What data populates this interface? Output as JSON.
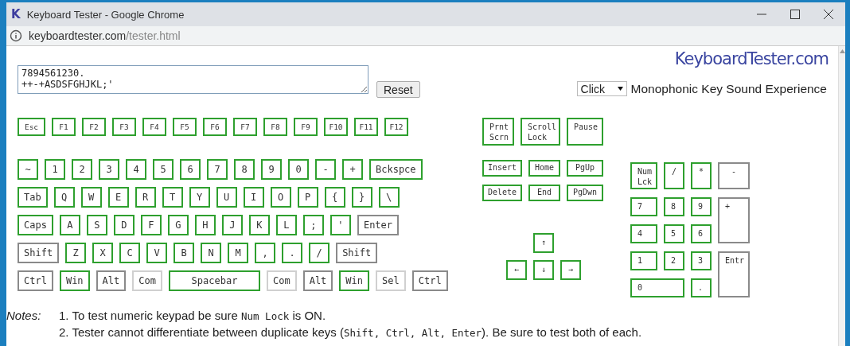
{
  "window": {
    "icon_letter": "K",
    "title": "Keyboard Tester - Google Chrome",
    "url_domain": "keyboardtester.com",
    "url_path": "/tester.html"
  },
  "input": {
    "value": "7894561230.\n++-+ASDSFGHJKL;'"
  },
  "reset_button": "Reset",
  "logo": "KeyboardTester.com",
  "sound": {
    "value": "Click",
    "label": "Monophonic Key Sound Experience"
  },
  "function_row": [
    {
      "label": "Esc",
      "tested": true,
      "disabled": false
    },
    {
      "label": "F1",
      "tested": true,
      "disabled": false
    },
    {
      "label": "F2",
      "tested": true,
      "disabled": false
    },
    {
      "label": "F3",
      "tested": true,
      "disabled": false
    },
    {
      "label": "F4",
      "tested": true,
      "disabled": false
    },
    {
      "label": "F5",
      "tested": true,
      "disabled": false
    },
    {
      "label": "F6",
      "tested": true,
      "disabled": false
    },
    {
      "label": "F7",
      "tested": true,
      "disabled": false
    },
    {
      "label": "F8",
      "tested": true,
      "disabled": false
    },
    {
      "label": "F9",
      "tested": true,
      "disabled": false
    },
    {
      "label": "F10",
      "tested": true,
      "disabled": false
    },
    {
      "label": "F11",
      "tested": true,
      "disabled": false
    },
    {
      "label": "F12",
      "tested": true,
      "disabled": false
    }
  ],
  "main_rows": [
    [
      {
        "label": "~",
        "tested": true,
        "disabled": false
      },
      {
        "label": "1",
        "tested": true,
        "disabled": false
      },
      {
        "label": "2",
        "tested": true,
        "disabled": false
      },
      {
        "label": "3",
        "tested": true,
        "disabled": false
      },
      {
        "label": "4",
        "tested": true,
        "disabled": false
      },
      {
        "label": "5",
        "tested": true,
        "disabled": false
      },
      {
        "label": "6",
        "tested": true,
        "disabled": false
      },
      {
        "label": "7",
        "tested": true,
        "disabled": false
      },
      {
        "label": "8",
        "tested": true,
        "disabled": false
      },
      {
        "label": "9",
        "tested": true,
        "disabled": false
      },
      {
        "label": "0",
        "tested": true,
        "disabled": false
      },
      {
        "label": "-",
        "tested": true,
        "disabled": false
      },
      {
        "label": "+",
        "tested": true,
        "disabled": false
      },
      {
        "label": "Bckspce",
        "tested": true,
        "disabled": false
      }
    ],
    [
      {
        "label": "Tab",
        "tested": true,
        "disabled": false
      },
      {
        "label": "Q",
        "tested": true,
        "disabled": false
      },
      {
        "label": "W",
        "tested": true,
        "disabled": false
      },
      {
        "label": "E",
        "tested": true,
        "disabled": false
      },
      {
        "label": "R",
        "tested": true,
        "disabled": false
      },
      {
        "label": "T",
        "tested": true,
        "disabled": false
      },
      {
        "label": "Y",
        "tested": true,
        "disabled": false
      },
      {
        "label": "U",
        "tested": true,
        "disabled": false
      },
      {
        "label": "I",
        "tested": true,
        "disabled": false
      },
      {
        "label": "O",
        "tested": true,
        "disabled": false
      },
      {
        "label": "P",
        "tested": true,
        "disabled": false
      },
      {
        "label": "{",
        "tested": true,
        "disabled": false
      },
      {
        "label": "}",
        "tested": true,
        "disabled": false
      },
      {
        "label": "\\",
        "tested": true,
        "disabled": false
      }
    ],
    [
      {
        "label": "Caps",
        "tested": true,
        "disabled": false
      },
      {
        "label": "A",
        "tested": true,
        "disabled": false
      },
      {
        "label": "S",
        "tested": true,
        "disabled": false
      },
      {
        "label": "D",
        "tested": true,
        "disabled": false
      },
      {
        "label": "F",
        "tested": true,
        "disabled": false
      },
      {
        "label": "G",
        "tested": true,
        "disabled": false
      },
      {
        "label": "H",
        "tested": true,
        "disabled": false
      },
      {
        "label": "J",
        "tested": true,
        "disabled": false
      },
      {
        "label": "K",
        "tested": true,
        "disabled": false
      },
      {
        "label": "L",
        "tested": true,
        "disabled": false
      },
      {
        "label": ";",
        "tested": true,
        "disabled": false
      },
      {
        "label": "'",
        "tested": true,
        "disabled": false
      },
      {
        "label": "Enter",
        "tested": false,
        "disabled": false
      }
    ],
    [
      {
        "label": "Shift",
        "tested": false,
        "disabled": false
      },
      {
        "label": "Z",
        "tested": true,
        "disabled": false
      },
      {
        "label": "X",
        "tested": true,
        "disabled": false
      },
      {
        "label": "C",
        "tested": true,
        "disabled": false
      },
      {
        "label": "V",
        "tested": true,
        "disabled": false
      },
      {
        "label": "B",
        "tested": true,
        "disabled": false
      },
      {
        "label": "N",
        "tested": true,
        "disabled": false
      },
      {
        "label": "M",
        "tested": true,
        "disabled": false
      },
      {
        "label": ",",
        "tested": true,
        "disabled": false
      },
      {
        "label": ".",
        "tested": true,
        "disabled": false
      },
      {
        "label": "/",
        "tested": true,
        "disabled": false
      },
      {
        "label": "Shift",
        "tested": false,
        "disabled": false
      }
    ],
    [
      {
        "label": "Ctrl",
        "tested": false,
        "disabled": false,
        "kind": "key"
      },
      {
        "label": "Win",
        "tested": true,
        "disabled": false,
        "kind": "key"
      },
      {
        "label": "Alt",
        "tested": false,
        "disabled": false,
        "kind": "key"
      },
      {
        "label": "Com",
        "tested": false,
        "disabled": true,
        "kind": "key"
      },
      {
        "label": "Spacebar",
        "tested": true,
        "disabled": false,
        "kind": "spacebar"
      },
      {
        "label": "Com",
        "tested": false,
        "disabled": true,
        "kind": "key"
      },
      {
        "label": "Alt",
        "tested": false,
        "disabled": false,
        "kind": "key"
      },
      {
        "label": "Win",
        "tested": true,
        "disabled": false,
        "kind": "key"
      },
      {
        "label": "Sel",
        "tested": false,
        "disabled": true,
        "kind": "key"
      },
      {
        "label": "Ctrl",
        "tested": false,
        "disabled": false,
        "kind": "key"
      }
    ]
  ],
  "nav_rows": [
    [
      {
        "label": "Prnt\nScrn",
        "tested": true,
        "disabled": false
      },
      {
        "label": "Scroll\nLock",
        "tested": true,
        "disabled": false
      },
      {
        "label": "Pause",
        "tested": true,
        "disabled": false
      }
    ],
    [
      {
        "label": "Insert",
        "tested": true,
        "disabled": false
      },
      {
        "label": "Home",
        "tested": true,
        "disabled": false
      },
      {
        "label": "PgUp",
        "tested": true,
        "disabled": false
      }
    ],
    [
      {
        "label": "Delete",
        "tested": true,
        "disabled": false
      },
      {
        "label": "End",
        "tested": true,
        "disabled": false
      },
      {
        "label": "PgDwn",
        "tested": true,
        "disabled": false
      }
    ]
  ],
  "arrows": [
    {
      "label": "↑",
      "tested": true,
      "disabled": false
    },
    {
      "label": "←",
      "tested": true,
      "disabled": false
    },
    {
      "label": "↓",
      "tested": true,
      "disabled": false
    },
    {
      "label": "→",
      "tested": true,
      "disabled": false
    }
  ],
  "numpad": [
    {
      "label": "Num\nLck",
      "tested": true,
      "disabled": false,
      "kind": "tall-top"
    },
    {
      "label": "/",
      "tested": true,
      "disabled": false,
      "kind": "tall-top"
    },
    {
      "label": "*",
      "tested": true,
      "disabled": false,
      "kind": "tall-top"
    },
    {
      "label": "-",
      "tested": false,
      "disabled": false,
      "kind": "tall-top"
    },
    {
      "label": "7",
      "tested": true,
      "disabled": false,
      "kind": "key"
    },
    {
      "label": "8",
      "tested": true,
      "disabled": false,
      "kind": "key"
    },
    {
      "label": "9",
      "tested": true,
      "disabled": false,
      "kind": "key"
    },
    {
      "label": "+",
      "tested": false,
      "disabled": false,
      "kind": "tall"
    },
    {
      "label": "4",
      "tested": true,
      "disabled": false,
      "kind": "key"
    },
    {
      "label": "5",
      "tested": true,
      "disabled": false,
      "kind": "key"
    },
    {
      "label": "6",
      "tested": true,
      "disabled": false,
      "kind": "key"
    },
    {
      "label": "1",
      "tested": true,
      "disabled": false,
      "kind": "key"
    },
    {
      "label": "2",
      "tested": true,
      "disabled": false,
      "kind": "key"
    },
    {
      "label": "3",
      "tested": true,
      "disabled": false,
      "kind": "key"
    },
    {
      "label": "Entr",
      "tested": false,
      "disabled": false,
      "kind": "tall"
    },
    {
      "label": "0",
      "tested": true,
      "disabled": false,
      "kind": "wide"
    },
    {
      "label": ".",
      "tested": true,
      "disabled": false,
      "kind": "key"
    }
  ],
  "notes": {
    "label": "Notes:",
    "items": [
      [
        {
          "kind": "text",
          "text": "1. To test numeric keypad be sure "
        },
        {
          "kind": "code",
          "text": "Num Lock"
        },
        {
          "kind": "text",
          "text": " is ON."
        }
      ],
      [
        {
          "kind": "text",
          "text": "2. Tester cannot differentiate between duplicate keys ("
        },
        {
          "kind": "code",
          "text": "Shift, Ctrl, Alt, Enter"
        },
        {
          "kind": "text",
          "text": "). Be sure to test both of each."
        }
      ]
    ]
  }
}
